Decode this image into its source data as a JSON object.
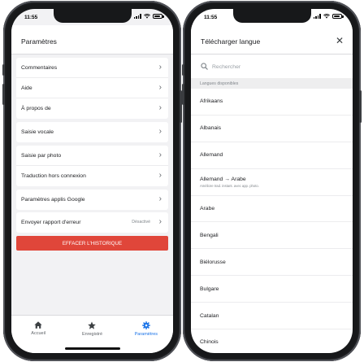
{
  "status_bar": {
    "time": "11:55"
  },
  "settings_screen": {
    "title": "Paramètres",
    "groups": [
      [
        {
          "label": "Commentaires"
        },
        {
          "label": "Aide"
        },
        {
          "label": "À propos de"
        }
      ],
      [
        {
          "label": "Saisie vocale"
        }
      ],
      [
        {
          "label": "Saisie par photo"
        },
        {
          "label": "Traduction hors connexion"
        }
      ],
      [
        {
          "label": "Paramètres applis Google"
        }
      ],
      [
        {
          "label": "Envoyer rapport d'erreur",
          "value": "Désactivé"
        }
      ]
    ],
    "clear_button": "EFFACER L'HISTORIQUE",
    "tabs": [
      {
        "label": "Accueil",
        "icon": "home-icon",
        "active": false
      },
      {
        "label": "Enregistré",
        "icon": "star-icon",
        "active": false
      },
      {
        "label": "Paramètres",
        "icon": "gear-icon",
        "active": true
      }
    ]
  },
  "download_screen": {
    "title": "Télécharger langue",
    "close_icon": "close-icon",
    "search_placeholder": "Rechercher",
    "section_header": "Langues disponibles",
    "languages": [
      {
        "name": "Afrikaans"
      },
      {
        "name": "Albanais"
      },
      {
        "name": "Allemand"
      },
      {
        "name": "Allemand → Arabe",
        "subtitle": "Améliore trad. instant. avec app. photo."
      },
      {
        "name": "Arabe"
      },
      {
        "name": "Bengali"
      },
      {
        "name": "Biélorusse"
      },
      {
        "name": "Bulgare"
      },
      {
        "name": "Catalan"
      },
      {
        "name": "Chinois"
      }
    ]
  },
  "colors": {
    "accent_blue": "#1a73e8",
    "clear_red": "#e0463a",
    "background_gray": "#f2f2f4"
  }
}
